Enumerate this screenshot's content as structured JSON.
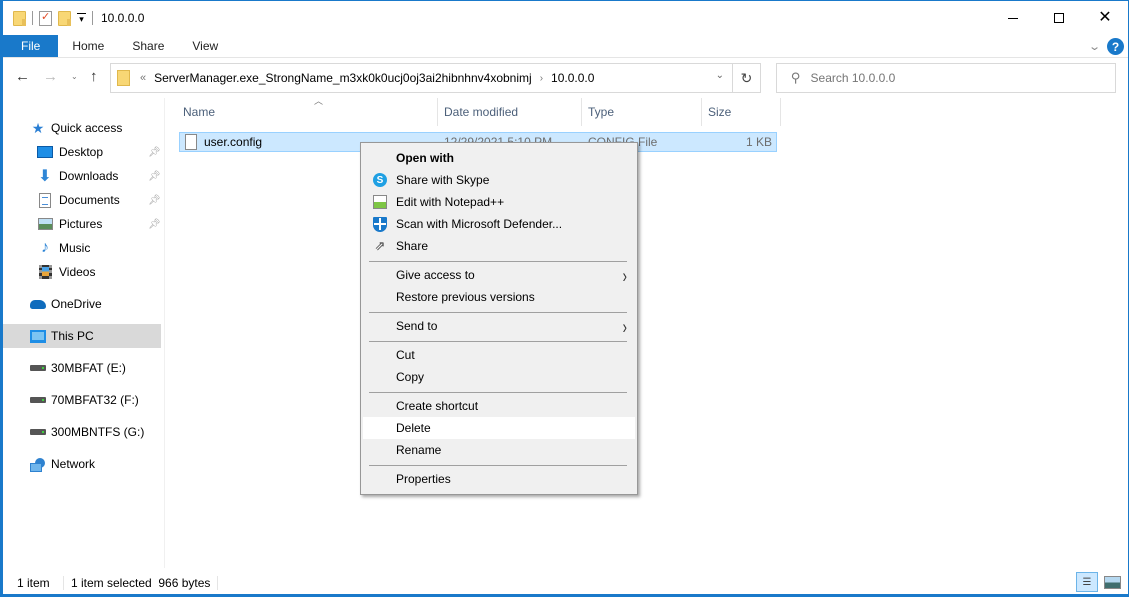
{
  "window": {
    "title": "10.0.0.0",
    "controls": {
      "minimize": "minimize",
      "maximize": "maximize",
      "close": "close"
    }
  },
  "ribbon": {
    "tabs": [
      {
        "label": "File",
        "active": true
      },
      {
        "label": "Home"
      },
      {
        "label": "Share"
      },
      {
        "label": "View"
      }
    ],
    "help_label": "?"
  },
  "address": {
    "overflow": "«",
    "segments": [
      "ServerManager.exe_StrongName_m3xk0k0ucj0oj3ai2hibnhnv4xobnimj",
      "10.0.0.0"
    ],
    "separator": "›"
  },
  "search": {
    "placeholder": "Search 10.0.0.0",
    "value": ""
  },
  "sidebar": {
    "items": [
      {
        "label": "Quick access",
        "icon": "star-icon"
      },
      {
        "label": "Desktop",
        "icon": "desktop-icon",
        "pinned": true
      },
      {
        "label": "Downloads",
        "icon": "downloads-icon",
        "pinned": true
      },
      {
        "label": "Documents",
        "icon": "documents-icon",
        "pinned": true
      },
      {
        "label": "Pictures",
        "icon": "pictures-icon",
        "pinned": true
      },
      {
        "label": "Music",
        "icon": "music-icon"
      },
      {
        "label": "Videos",
        "icon": "videos-icon"
      },
      {
        "label": "OneDrive",
        "icon": "onedrive-icon"
      },
      {
        "label": "This PC",
        "icon": "this-pc-icon",
        "selected": true
      },
      {
        "label": "30MBFAT (E:)",
        "icon": "drive-icon"
      },
      {
        "label": "70MBFAT32 (F:)",
        "icon": "drive-icon"
      },
      {
        "label": "300MBNTFS (G:)",
        "icon": "drive-icon"
      },
      {
        "label": "Network",
        "icon": "network-icon"
      }
    ]
  },
  "filelist": {
    "columns": [
      "Name",
      "Date modified",
      "Type",
      "Size"
    ],
    "sort_indicator": "^",
    "rows": [
      {
        "name": "user.config",
        "date": "12/29/2021 5:10 PM",
        "type": "CONFIG File",
        "size": "1 KB",
        "selected": true
      }
    ]
  },
  "context_menu": {
    "items": [
      {
        "label": "Open with",
        "bold": true
      },
      {
        "label": "Share with Skype",
        "icon": "skype-icon"
      },
      {
        "label": "Edit with Notepad++",
        "icon": "notepad-plus-plus-icon"
      },
      {
        "label": "Scan with Microsoft Defender...",
        "icon": "defender-icon"
      },
      {
        "label": "Share",
        "icon": "share-icon"
      },
      {
        "label": "Give access to",
        "submenu": true
      },
      {
        "label": "Restore previous versions"
      },
      {
        "label": "Send to",
        "submenu": true
      },
      {
        "label": "Cut"
      },
      {
        "label": "Copy"
      },
      {
        "label": "Create shortcut"
      },
      {
        "label": "Delete",
        "hovered": true
      },
      {
        "label": "Rename"
      },
      {
        "label": "Properties"
      }
    ]
  },
  "statusbar": {
    "item_count": "1 item",
    "selection": "1 item selected  966 bytes"
  }
}
